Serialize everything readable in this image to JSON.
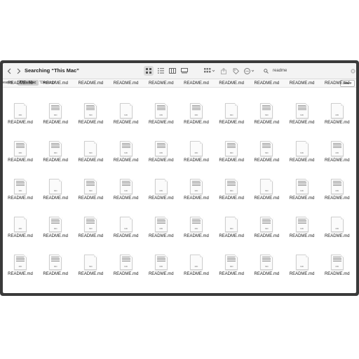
{
  "window": {
    "title": "Searching “This Mac”"
  },
  "toolbar": {
    "back_icon": "chevron-left-icon",
    "forward_icon": "chevron-right-icon",
    "view_modes": [
      "icon-view-icon",
      "list-view-icon",
      "column-view-icon",
      "gallery-view-icon"
    ],
    "active_view": "icon-view-icon"
  },
  "search": {
    "query": "readme"
  },
  "scope": {
    "label": "earch:",
    "this_mac": "This Mac",
    "desktop": "“Desktop”",
    "save": "Save"
  },
  "files": {
    "label": "README.md",
    "badge": "MD",
    "rows": 6,
    "columns": 10
  }
}
